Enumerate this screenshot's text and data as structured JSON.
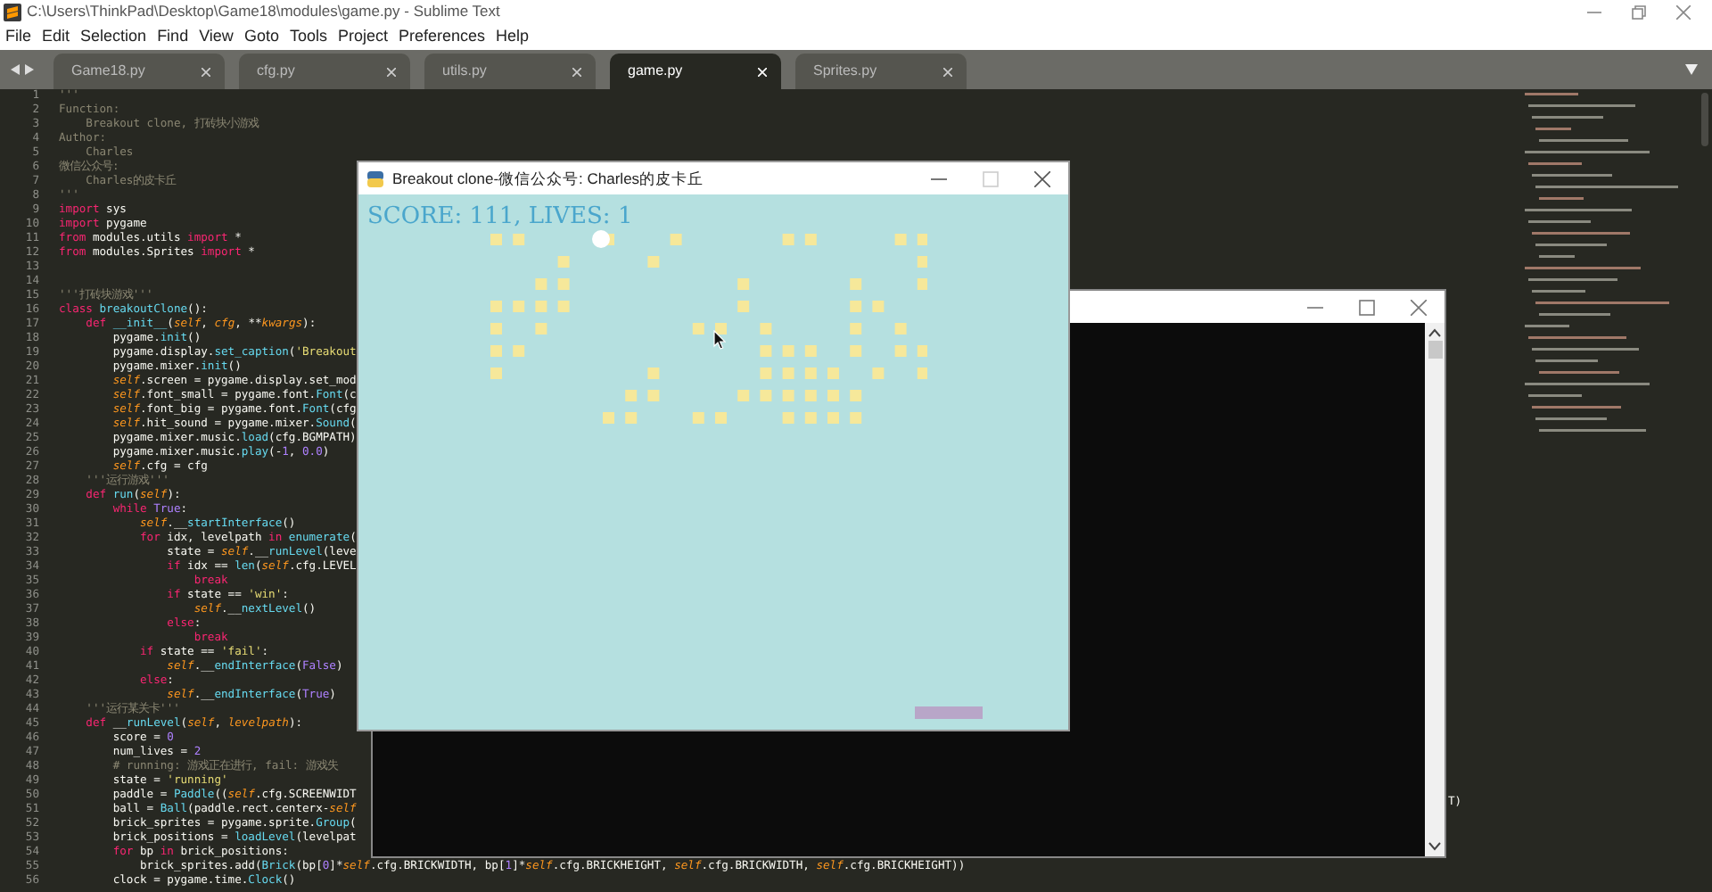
{
  "app_window": {
    "title": "C:\\Users\\ThinkPad\\Desktop\\Game18\\modules\\game.py - Sublime Text"
  },
  "menu": [
    "File",
    "Edit",
    "Selection",
    "Find",
    "View",
    "Goto",
    "Tools",
    "Project",
    "Preferences",
    "Help"
  ],
  "tabs": [
    {
      "label": "Game18.py",
      "selected": false
    },
    {
      "label": "cfg.py",
      "selected": false
    },
    {
      "label": "utils.py",
      "selected": false
    },
    {
      "label": "game.py",
      "selected": true
    },
    {
      "label": "Sprites.py",
      "selected": false
    }
  ],
  "code_lines": [
    {
      "number": "1",
      "segments": [
        {
          "kind": "comment",
          "text": "'''"
        }
      ]
    },
    {
      "number": "2",
      "segments": [
        {
          "kind": "comment",
          "text": "Function:"
        }
      ]
    },
    {
      "number": "3",
      "segments": [
        {
          "kind": "comment",
          "text": "    Breakout clone, 打砖块小游戏"
        }
      ]
    },
    {
      "number": "4",
      "segments": [
        {
          "kind": "comment",
          "text": "Author:"
        }
      ]
    },
    {
      "number": "5",
      "segments": [
        {
          "kind": "comment",
          "text": "    Charles"
        }
      ]
    },
    {
      "number": "6",
      "segments": [
        {
          "kind": "comment",
          "text": "微信公众号:"
        }
      ]
    },
    {
      "number": "7",
      "segments": [
        {
          "kind": "comment",
          "text": "    Charles的皮卡丘"
        }
      ]
    },
    {
      "number": "8",
      "segments": [
        {
          "kind": "comment",
          "text": "'''"
        }
      ]
    },
    {
      "number": "9",
      "segments": [
        {
          "kind": "keyword",
          "text": "import"
        },
        {
          "kind": "plain",
          "text": " sys"
        }
      ]
    },
    {
      "number": "10",
      "segments": [
        {
          "kind": "keyword",
          "text": "import"
        },
        {
          "kind": "plain",
          "text": " pygame"
        }
      ]
    },
    {
      "number": "11",
      "segments": [
        {
          "kind": "keyword",
          "text": "from"
        },
        {
          "kind": "plain",
          "text": " modules.utils "
        },
        {
          "kind": "keyword",
          "text": "import"
        },
        {
          "kind": "plain",
          "text": " *"
        }
      ]
    },
    {
      "number": "12",
      "segments": [
        {
          "kind": "keyword",
          "text": "from"
        },
        {
          "kind": "plain",
          "text": " modules.Sprites "
        },
        {
          "kind": "keyword",
          "text": "import"
        },
        {
          "kind": "plain",
          "text": " *"
        }
      ]
    },
    {
      "number": "13"
    },
    {
      "number": "14"
    },
    {
      "number": "15",
      "segments": [
        {
          "kind": "comment",
          "text": "'''打砖块游戏'''"
        }
      ]
    },
    {
      "number": "16",
      "segments": [
        {
          "kind": "keyword",
          "text": "class"
        },
        {
          "kind": "function",
          "text": " breakoutClone"
        },
        {
          "kind": "plain",
          "text": "():"
        }
      ]
    },
    {
      "number": "17",
      "segments": [
        {
          "kind": "keyword",
          "text": "    def"
        },
        {
          "kind": "function",
          "text": " __init__"
        },
        {
          "kind": "plain",
          "text": "("
        },
        {
          "kind": "self",
          "text": "self"
        },
        {
          "kind": "plain",
          "text": ", "
        },
        {
          "kind": "self",
          "text": "cfg"
        },
        {
          "kind": "plain",
          "text": ", **"
        },
        {
          "kind": "self",
          "text": "kwargs"
        },
        {
          "kind": "plain",
          "text": "):"
        }
      ]
    },
    {
      "number": "18",
      "segments": [
        {
          "kind": "plain",
          "text": "        pygame."
        },
        {
          "kind": "function",
          "text": "init"
        },
        {
          "kind": "plain",
          "text": "()"
        }
      ]
    },
    {
      "number": "19",
      "segments": [
        {
          "kind": "plain",
          "text": "        pygame.display."
        },
        {
          "kind": "function",
          "text": "set_caption"
        },
        {
          "kind": "plain",
          "text": "("
        },
        {
          "kind": "string",
          "text": "'Breakout"
        }
      ]
    },
    {
      "number": "20",
      "segments": [
        {
          "kind": "plain",
          "text": "        pygame.mixer."
        },
        {
          "kind": "function",
          "text": "init"
        },
        {
          "kind": "plain",
          "text": "()"
        }
      ]
    },
    {
      "number": "21",
      "segments": [
        {
          "kind": "self",
          "text": "        self"
        },
        {
          "kind": "plain",
          "text": ".screen = pygame.display.set_mod"
        }
      ]
    },
    {
      "number": "22",
      "segments": [
        {
          "kind": "self",
          "text": "        self"
        },
        {
          "kind": "plain",
          "text": ".font_small = pygame.font."
        },
        {
          "kind": "function",
          "text": "Font"
        },
        {
          "kind": "plain",
          "text": "(c"
        }
      ]
    },
    {
      "number": "23",
      "segments": [
        {
          "kind": "self",
          "text": "        self"
        },
        {
          "kind": "plain",
          "text": ".font_big = pygame.font."
        },
        {
          "kind": "function",
          "text": "Font"
        },
        {
          "kind": "plain",
          "text": "(cfg"
        }
      ]
    },
    {
      "number": "24",
      "segments": [
        {
          "kind": "self",
          "text": "        self"
        },
        {
          "kind": "plain",
          "text": ".hit_sound = pygame.mixer."
        },
        {
          "kind": "function",
          "text": "Sound"
        },
        {
          "kind": "plain",
          "text": "("
        }
      ]
    },
    {
      "number": "25",
      "segments": [
        {
          "kind": "plain",
          "text": "        pygame.mixer.music."
        },
        {
          "kind": "function",
          "text": "load"
        },
        {
          "kind": "plain",
          "text": "(cfg.BGMPATH)"
        }
      ]
    },
    {
      "number": "26",
      "segments": [
        {
          "kind": "plain",
          "text": "        pygame.mixer.music."
        },
        {
          "kind": "function",
          "text": "play"
        },
        {
          "kind": "plain",
          "text": "(-"
        },
        {
          "kind": "number",
          "text": "1"
        },
        {
          "kind": "plain",
          "text": ", "
        },
        {
          "kind": "number",
          "text": "0.0"
        },
        {
          "kind": "plain",
          "text": ")"
        }
      ]
    },
    {
      "number": "27",
      "segments": [
        {
          "kind": "self",
          "text": "        self"
        },
        {
          "kind": "plain",
          "text": ".cfg = cfg"
        }
      ]
    },
    {
      "number": "28",
      "segments": [
        {
          "kind": "comment",
          "text": "    '''运行游戏'''"
        }
      ]
    },
    {
      "number": "29",
      "segments": [
        {
          "kind": "keyword",
          "text": "    def"
        },
        {
          "kind": "function",
          "text": " run"
        },
        {
          "kind": "plain",
          "text": "("
        },
        {
          "kind": "self",
          "text": "self"
        },
        {
          "kind": "plain",
          "text": "):"
        }
      ]
    },
    {
      "number": "30",
      "segments": [
        {
          "kind": "keyword",
          "text": "        while"
        },
        {
          "kind": "number",
          "text": " True"
        },
        {
          "kind": "plain",
          "text": ":"
        }
      ]
    },
    {
      "number": "31",
      "segments": [
        {
          "kind": "self",
          "text": "            self"
        },
        {
          "kind": "plain",
          "text": ".__"
        },
        {
          "kind": "function",
          "text": "startInterface"
        },
        {
          "kind": "plain",
          "text": "()"
        }
      ]
    },
    {
      "number": "32",
      "segments": [
        {
          "kind": "keyword",
          "text": "            for"
        },
        {
          "kind": "plain",
          "text": " idx, levelpath "
        },
        {
          "kind": "keyword",
          "text": "in"
        },
        {
          "kind": "function",
          "text": " enumerate"
        },
        {
          "kind": "plain",
          "text": "("
        }
      ]
    },
    {
      "number": "33",
      "segments": [
        {
          "kind": "plain",
          "text": "                state = "
        },
        {
          "kind": "self",
          "text": "self"
        },
        {
          "kind": "plain",
          "text": ".__"
        },
        {
          "kind": "function",
          "text": "runLevel"
        },
        {
          "kind": "plain",
          "text": "(leve"
        }
      ]
    },
    {
      "number": "34",
      "segments": [
        {
          "kind": "keyword",
          "text": "                if"
        },
        {
          "kind": "plain",
          "text": " idx == "
        },
        {
          "kind": "function",
          "text": "len"
        },
        {
          "kind": "plain",
          "text": "("
        },
        {
          "kind": "self",
          "text": "self"
        },
        {
          "kind": "plain",
          "text": ".cfg.LEVEL"
        }
      ]
    },
    {
      "number": "35",
      "segments": [
        {
          "kind": "keyword",
          "text": "                    break"
        }
      ]
    },
    {
      "number": "36",
      "segments": [
        {
          "kind": "keyword",
          "text": "                if"
        },
        {
          "kind": "plain",
          "text": " state == "
        },
        {
          "kind": "string",
          "text": "'win'"
        },
        {
          "kind": "plain",
          "text": ":"
        }
      ]
    },
    {
      "number": "37",
      "segments": [
        {
          "kind": "self",
          "text": "                    self"
        },
        {
          "kind": "plain",
          "text": ".__"
        },
        {
          "kind": "function",
          "text": "nextLevel"
        },
        {
          "kind": "plain",
          "text": "()"
        }
      ]
    },
    {
      "number": "38",
      "segments": [
        {
          "kind": "keyword",
          "text": "                else"
        },
        {
          "kind": "plain",
          "text": ":"
        }
      ]
    },
    {
      "number": "39",
      "segments": [
        {
          "kind": "keyword",
          "text": "                    break"
        }
      ]
    },
    {
      "number": "40",
      "segments": [
        {
          "kind": "keyword",
          "text": "            if"
        },
        {
          "kind": "plain",
          "text": " state == "
        },
        {
          "kind": "string",
          "text": "'fail'"
        },
        {
          "kind": "plain",
          "text": ":"
        }
      ]
    },
    {
      "number": "41",
      "segments": [
        {
          "kind": "self",
          "text": "                self"
        },
        {
          "kind": "plain",
          "text": ".__"
        },
        {
          "kind": "function",
          "text": "endInterface"
        },
        {
          "kind": "plain",
          "text": "("
        },
        {
          "kind": "number",
          "text": "False"
        },
        {
          "kind": "plain",
          "text": ")"
        }
      ]
    },
    {
      "number": "42",
      "segments": [
        {
          "kind": "keyword",
          "text": "            else"
        },
        {
          "kind": "plain",
          "text": ":"
        }
      ]
    },
    {
      "number": "43",
      "segments": [
        {
          "kind": "self",
          "text": "                self"
        },
        {
          "kind": "plain",
          "text": ".__"
        },
        {
          "kind": "function",
          "text": "endInterface"
        },
        {
          "kind": "plain",
          "text": "("
        },
        {
          "kind": "number",
          "text": "True"
        },
        {
          "kind": "plain",
          "text": ")"
        }
      ]
    },
    {
      "number": "44",
      "segments": [
        {
          "kind": "comment",
          "text": "    '''运行某关卡'''"
        }
      ]
    },
    {
      "number": "45",
      "segments": [
        {
          "kind": "keyword",
          "text": "    def"
        },
        {
          "kind": "plain",
          "text": " __"
        },
        {
          "kind": "function",
          "text": "runLevel"
        },
        {
          "kind": "plain",
          "text": "("
        },
        {
          "kind": "self",
          "text": "self"
        },
        {
          "kind": "plain",
          "text": ", "
        },
        {
          "kind": "self",
          "text": "levelpath"
        },
        {
          "kind": "plain",
          "text": "):"
        }
      ]
    },
    {
      "number": "46",
      "segments": [
        {
          "kind": "plain",
          "text": "        score = "
        },
        {
          "kind": "number",
          "text": "0"
        }
      ]
    },
    {
      "number": "47",
      "segments": [
        {
          "kind": "plain",
          "text": "        num_lives = "
        },
        {
          "kind": "number",
          "text": "2"
        }
      ]
    },
    {
      "number": "48",
      "segments": [
        {
          "kind": "comment",
          "text": "        # running: 游戏正在进行, fail: 游戏失"
        }
      ]
    },
    {
      "number": "49",
      "segments": [
        {
          "kind": "plain",
          "text": "        state = "
        },
        {
          "kind": "string",
          "text": "'running'"
        }
      ]
    },
    {
      "number": "50",
      "segments": [
        {
          "kind": "plain",
          "text": "        paddle = "
        },
        {
          "kind": "function",
          "text": "Paddle"
        },
        {
          "kind": "plain",
          "text": "(("
        },
        {
          "kind": "self",
          "text": "self"
        },
        {
          "kind": "plain",
          "text": ".cfg.SCREENWIDT"
        }
      ]
    },
    {
      "number": "51",
      "segments": [
        {
          "kind": "plain",
          "text": "        ball = "
        },
        {
          "kind": "function",
          "text": "Ball"
        },
        {
          "kind": "plain",
          "text": "(paddle.rect.centerx-"
        },
        {
          "kind": "self",
          "text": "self"
        }
      ]
    },
    {
      "number": "52",
      "segments": [
        {
          "kind": "plain",
          "text": "        brick_sprites = pygame.sprite."
        },
        {
          "kind": "function",
          "text": "Group"
        },
        {
          "kind": "plain",
          "text": "("
        }
      ]
    },
    {
      "number": "53",
      "segments": [
        {
          "kind": "plain",
          "text": "        brick_positions = "
        },
        {
          "kind": "function",
          "text": "loadLevel"
        },
        {
          "kind": "plain",
          "text": "(levelpat"
        }
      ]
    },
    {
      "number": "54",
      "segments": [
        {
          "kind": "keyword",
          "text": "        for"
        },
        {
          "kind": "plain",
          "text": " bp "
        },
        {
          "kind": "keyword",
          "text": "in"
        },
        {
          "kind": "plain",
          "text": " brick_positions:"
        }
      ]
    },
    {
      "number": "55",
      "segments": [
        {
          "kind": "plain",
          "text": "            brick_sprites.add("
        },
        {
          "kind": "function",
          "text": "Brick"
        },
        {
          "kind": "plain",
          "text": "(bp["
        },
        {
          "kind": "number",
          "text": "0"
        },
        {
          "kind": "plain",
          "text": "]*"
        },
        {
          "kind": "self",
          "text": "self"
        },
        {
          "kind": "plain",
          "text": ".cfg.BRICKWIDTH, bp["
        },
        {
          "kind": "number",
          "text": "1"
        },
        {
          "kind": "plain",
          "text": "]*"
        },
        {
          "kind": "self",
          "text": "self"
        },
        {
          "kind": "plain",
          "text": ".cfg.BRICKHEIGHT, "
        },
        {
          "kind": "self",
          "text": "self"
        },
        {
          "kind": "plain",
          "text": ".cfg.BRICKWIDTH, "
        },
        {
          "kind": "self",
          "text": "self"
        },
        {
          "kind": "plain",
          "text": ".cfg.BRICKHEIGHT))"
        }
      ]
    },
    {
      "number": "56",
      "segments": [
        {
          "kind": "plain",
          "text": "        clock = pygame.time."
        },
        {
          "kind": "function",
          "text": "Clock"
        },
        {
          "kind": "plain",
          "text": "()"
        }
      ]
    }
  ],
  "line_50_tail": "T)",
  "game_window": {
    "title": "Breakout clone-微信公众号: Charles的皮卡丘",
    "hud": "SCORE: 111, LIVES: 1"
  }
}
